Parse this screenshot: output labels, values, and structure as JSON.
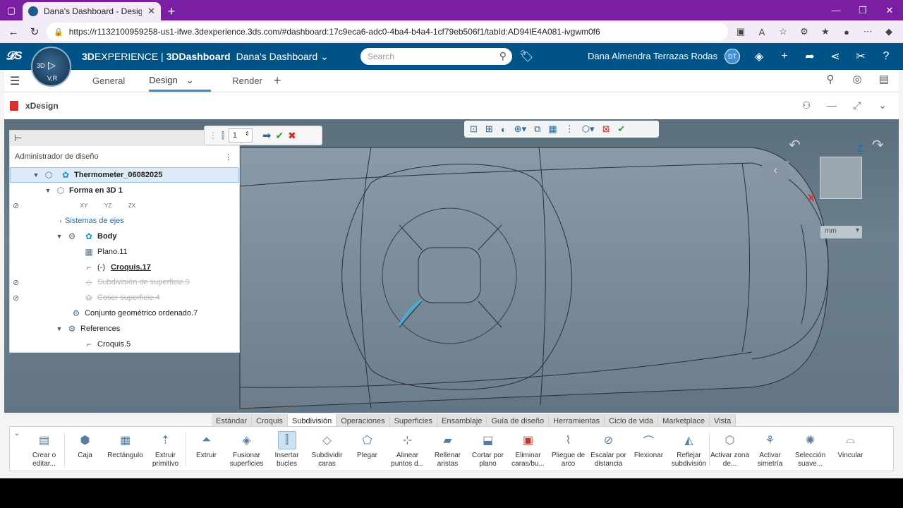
{
  "browser": {
    "tab_title": "Dana's Dashboard - Design",
    "url": "https://r1132100959258-us1-ifwe.3dexperience.3ds.com/#dashboard:17c9eca6-adc0-4ba4-b4a4-1cf79eb506f1/tabId:AD94IE4A081-ivgwm0f6"
  },
  "header": {
    "brand_prefix": "3D",
    "brand_rest": "EXPERIENCE | ",
    "brand_app": "3DDashboard",
    "dashboard": "Dana's Dashboard",
    "search_placeholder": "Search",
    "user": "Dana Almendra Terrazas Rodas",
    "avatar_initials": "DT",
    "compass_3d": "3D",
    "compass_vr": "V,R"
  },
  "dashtabs": {
    "tab1": "General",
    "tab2": "Design",
    "tab3": "Render"
  },
  "widget": {
    "title": "xDesign"
  },
  "tree": {
    "title": "Administrador de diseño",
    "rows": {
      "root": "Thermometer_06082025",
      "shape": "Forma en 3D 1",
      "axes": "Sistemas de ejes",
      "body": "Body",
      "plane": "Plano.11",
      "sketch17_prefix": "(-)",
      "sketch17": "Croquis.17",
      "subdiv": "Subdivisión de superficie.9",
      "sew": "Coser superficie.4",
      "geoset": "Conjunto geométrico ordenado.7",
      "refs": "References",
      "sketch5": "Croquis.5"
    },
    "plane_labels": [
      "XY",
      "YZ",
      "ZX"
    ]
  },
  "sketch_toolbar": {
    "value": "1"
  },
  "viewport": {
    "unit": "mm",
    "axis_z": "Z",
    "axis_x": "X"
  },
  "action_tabs": [
    "Estándar",
    "Croquis",
    "Subdivisión",
    "Operaciones",
    "Superficies",
    "Ensamblaje",
    "Guía de diseño",
    "Herramientas",
    "Ciclo de vida",
    "Marketplace",
    "Vista"
  ],
  "commands": {
    "c1": "Crear o editar...",
    "c2": "Caja",
    "c3": "Rectángulo",
    "c4": "Extruir primitivo",
    "c5": "Extruir",
    "c6": "Fusionar superficies",
    "c7": "Insertar bucles",
    "c8": "Subdividir caras",
    "c9": "Plegar",
    "c10": "Alinear puntos d...",
    "c11": "Rellenar aristas",
    "c12": "Cortar por plano",
    "c13": "Eliminar caras/bu...",
    "c14": "Pliegue de arco",
    "c15": "Escalar por distancia",
    "c16": "Flexionar",
    "c17": "Reflejar subdivisión",
    "c18": "Activar zona de...",
    "c19": "Activar simetría",
    "c20": "Selección suave...",
    "c21": "Vincular"
  },
  "colors": {
    "browser_tabbar": "#7a1fa2",
    "header_blue": "#005386",
    "accent": "#368ec4",
    "selection_curve": "#38b6e8"
  }
}
